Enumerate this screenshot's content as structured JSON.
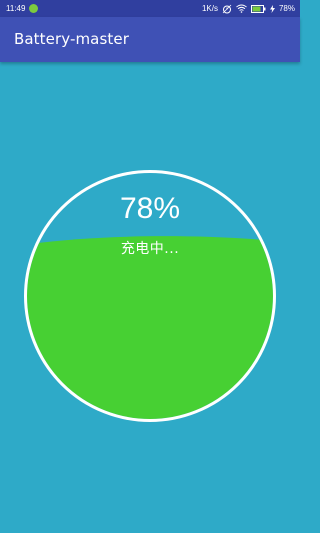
{
  "status_bar": {
    "time": "11:49",
    "network_speed": "1K/s",
    "battery_percent": "78%",
    "icons": [
      "notification-icon",
      "network-speed-icon",
      "alarm-icon",
      "wifi-icon",
      "battery-icon",
      "charging-bolt-icon"
    ]
  },
  "app": {
    "title": "Battery-master",
    "primary_color": "#3F51B5",
    "status_bar_color": "#303F9F"
  },
  "battery": {
    "level": 0.78,
    "percent_label": "78%",
    "status_label": "充电中...",
    "fill_color": "#47D033",
    "background_color": "#2EAAC8",
    "ring_color": "#FFFFFF"
  }
}
